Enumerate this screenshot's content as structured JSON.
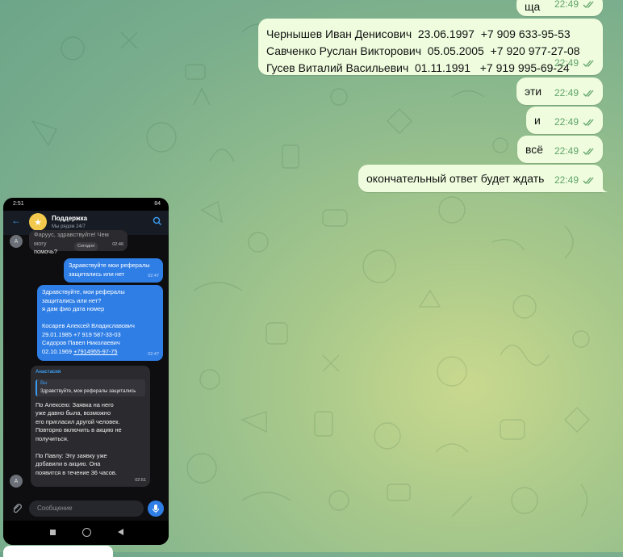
{
  "messages": [
    {
      "text": "ща",
      "time": "22:49"
    },
    {
      "lines": [
        "Чернышев Иван Денисович  23.06.1997  +7 909 633-95-53",
        "Савченко Руслан Викторович  05.05.2005  +7 920 977-27-08",
        "Гусев Виталий Васильевич  01.11.1991   +7 919 995-69-24"
      ],
      "time": "22:49"
    },
    {
      "text": "эти",
      "time": "22:49"
    },
    {
      "text": "и",
      "time": "22:49"
    },
    {
      "text": "всё",
      "time": "22:49"
    },
    {
      "text": "окончательный ответ будет ждать",
      "time": "22:49"
    }
  ],
  "phone": {
    "status_time": "2:51",
    "status_right": "84",
    "header": {
      "title": "Поддержка",
      "subtitle": "Мы рядом 24/7"
    },
    "first_msg": {
      "text_top": "Фаруус, здравствуйте! Чем могу",
      "text_bottom": "помочь?",
      "time": "02:46",
      "date_chip": "Сегодня",
      "avatar": "А"
    },
    "out1": {
      "lines": [
        "Здравствуйте мои рефералы",
        "защитались или нет"
      ],
      "time": "02:47"
    },
    "out2": {
      "lines": [
        "Здравствуйте, мои рефералы",
        "защитались или нет?",
        "я дам фио дата номер",
        "",
        "Косарев Алексей Владиславович",
        "29.01.1985 +7 919 587-33-03",
        "Сидоров Павел Николаевич"
      ],
      "last_date": "02.10.1969",
      "last_phone": "+7914955-97-75",
      "time": "02:47"
    },
    "reply": {
      "author": "Анастасия",
      "quote_author": "Вы",
      "quote_text": "Здравствуйте, мои рефералы защитались",
      "lines": [
        "По Алексею: Заявка на него",
        "уже давно была, возможно",
        "его пригласил другой человек.",
        "Повторно включить в акцию не",
        "получиться.",
        "",
        "По Павлу: Эту заявку уже",
        "добавили в акцию. Она",
        "появится в течение 36 часов."
      ],
      "time": "02:51",
      "avatar": "А"
    },
    "input_placeholder": "Сообщение"
  },
  "colors": {
    "bubble_out": "#effdde",
    "check": "#5fa36a",
    "phone_out": "#2f7ee6"
  }
}
